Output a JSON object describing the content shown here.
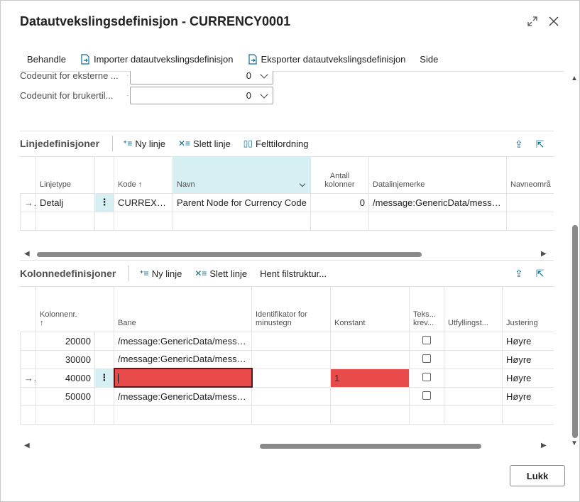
{
  "dialog": {
    "title": "Datautvekslingsdefinisjon - CURRENCY0001",
    "expand_icon": "expand-icon",
    "close_icon": "close-icon"
  },
  "actionbar": {
    "items": [
      {
        "label": "Behandle"
      },
      {
        "label": "Importer datautvekslingsdefinisjon",
        "icon": "import-icon"
      },
      {
        "label": "Eksporter datautvekslingsdefinisjon",
        "icon": "export-icon"
      },
      {
        "label": "Side"
      }
    ]
  },
  "fields": [
    {
      "label": "Codeunit for eksterne ...",
      "value": "0"
    },
    {
      "label": "Codeunit for brukertil...",
      "value": "0"
    }
  ],
  "line_defs": {
    "title": "Linjedefinisjoner",
    "actions": [
      {
        "label": "Ny linje",
        "icon": "new-line-icon"
      },
      {
        "label": "Slett linje",
        "icon": "delete-line-icon"
      },
      {
        "label": "Felttilordning",
        "icon": "field-mapping-icon"
      }
    ],
    "columns": [
      "Linjetype",
      "Kode ↑",
      "Navn",
      "Antall kolonner",
      "Datalinjemerke",
      "Navneområ"
    ],
    "rows": [
      {
        "linjetype": "Detalj",
        "kode": "CURREXCH...",
        "navn": "Parent Node for Currency Code",
        "antall": "0",
        "datalinjemerke": "/message:GenericData/messag...",
        "navneomrade": ""
      }
    ]
  },
  "col_defs": {
    "title": "Kolonnedefinisjoner",
    "actions": [
      {
        "label": "Ny linje",
        "icon": "new-line-icon"
      },
      {
        "label": "Slett linje",
        "icon": "delete-line-icon"
      },
      {
        "label": "Hent filstruktur..."
      }
    ],
    "columns": [
      "Kolonnenr.",
      "Bane",
      "Identifikator for minustegn",
      "Konstant",
      "Teks... krev...",
      "Utfyllingst...",
      "Justering"
    ],
    "rows": [
      {
        "nr": "20000",
        "bane": "/message:GenericData/messag...",
        "ident": "",
        "konstant": "",
        "justering": "Høyre",
        "selected": false
      },
      {
        "nr": "30000",
        "bane": "/message:GenericData/messag...",
        "ident": "",
        "konstant": "",
        "justering": "Høyre",
        "selected": false
      },
      {
        "nr": "40000",
        "bane": "",
        "ident": "",
        "konstant": "1",
        "justering": "Høyre",
        "selected": true
      },
      {
        "nr": "50000",
        "bane": "/message:GenericData/messag...",
        "ident": "",
        "konstant": "",
        "justering": "Høyre",
        "selected": false
      }
    ]
  },
  "footer": {
    "close_label": "Lukk"
  },
  "colors": {
    "accent": "#0f6f8f",
    "selected_cell": "#d6eff2",
    "error_fill": "#e94b4b"
  }
}
